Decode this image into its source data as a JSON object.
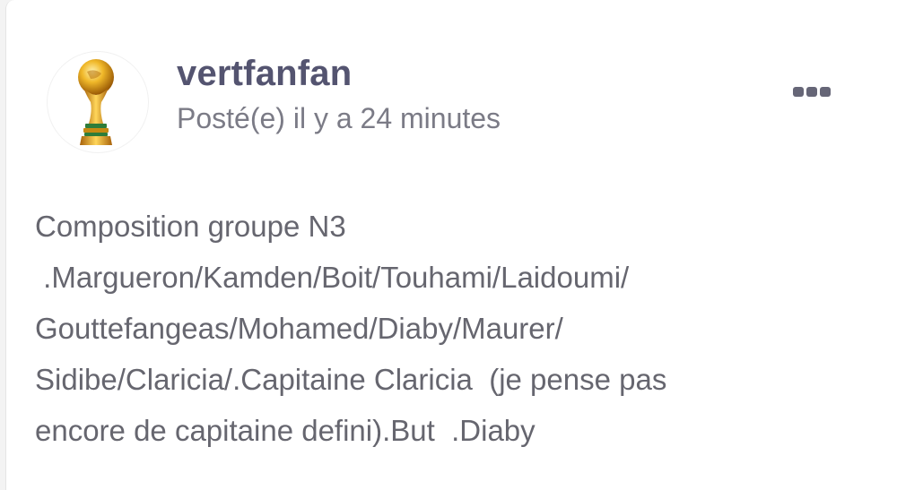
{
  "post": {
    "author": {
      "username": "vertfanfan",
      "avatar": "world-cup-trophy-avatar"
    },
    "timestamp": "Posté(e) il y a 24 minutes",
    "menu_icon": "more-options-icon",
    "body_lines": [
      "Composition groupe N3",
      " .Margueron/Kamden/Boit/Touhami/Laidoumi/",
      "Gouttefangeas/Mohamed/Diaby/Maurer/",
      "Sidibe/Claricia/.Capitaine Claricia  (je pense pas",
      "encore de capitaine defini).But  .Diaby"
    ]
  },
  "colors": {
    "username": "#545470",
    "timestamp": "#7b7b86",
    "body_text": "#66666f",
    "card_background": "#ffffff",
    "trophy_gold": "#d9a21a",
    "menu_dots": "#666677"
  }
}
